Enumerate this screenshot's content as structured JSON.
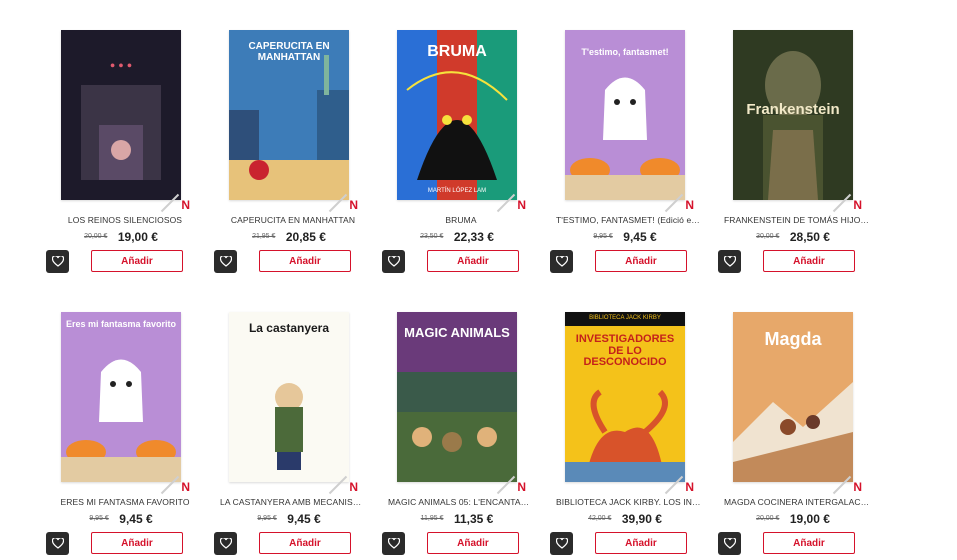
{
  "badge_letter": "N",
  "products": [
    {
      "title": "LOS REINOS SILENCIOSOS",
      "old_price": "20,00 €",
      "price": "19,00 €",
      "add_label": "Añadir",
      "cover_text": "",
      "cover_author": "",
      "colors": {
        "bg": "#1d1a2a",
        "accent": "#b0203a",
        "text": "#e05a6e"
      }
    },
    {
      "title": "CAPERUCITA EN MANHATTAN",
      "old_price": "21,95 €",
      "price": "20,85 €",
      "add_label": "Añadir",
      "cover_text": "CAPERUCITA EN MANHATTAN",
      "cover_author": "",
      "colors": {
        "bg": "#3d7cb8",
        "accent": "#e0b24a",
        "text": "#ffffff"
      }
    },
    {
      "title": "BRUMA",
      "old_price": "23,50 €",
      "price": "22,33 €",
      "add_label": "Añadir",
      "cover_text": "BRUMA",
      "cover_author": "MARTÍN LÓPEZ LAM",
      "colors": {
        "bg": "#d03a2b",
        "accent": "#2a6fd6",
        "text": "#ffffff"
      }
    },
    {
      "title": "T'ESTIMO, FANTASMET! (Edició en c...",
      "old_price": "9,95 €",
      "price": "9,45 €",
      "add_label": "Añadir",
      "cover_text": "T'estimo, fantasmet!",
      "cover_author": "",
      "colors": {
        "bg": "#b98ed6",
        "accent": "#f08a2b",
        "text": "#ffffff"
      }
    },
    {
      "title": "FRANKENSTEIN DE TOMÁS HIJO (No...",
      "old_price": "30,00 €",
      "price": "28,50 €",
      "add_label": "Añadir",
      "cover_text": "Frankenstein",
      "cover_author": "",
      "colors": {
        "bg": "#2f3a22",
        "accent": "#8a7a4a",
        "text": "#f2e9c8"
      }
    },
    {
      "title": "ERES MI FANTASMA FAVORITO",
      "old_price": "9,95 €",
      "price": "9,45 €",
      "add_label": "Añadir",
      "cover_text": "Eres mi fantasma favorito",
      "cover_author": "",
      "colors": {
        "bg": "#b98ed6",
        "accent": "#f08a2b",
        "text": "#ffffff"
      }
    },
    {
      "title": "LA CASTANYERA AMB MECANISMES...",
      "old_price": "9,95 €",
      "price": "9,45 €",
      "add_label": "Añadir",
      "cover_text": "La castanyera",
      "cover_author": "",
      "colors": {
        "bg": "#fbfaf3",
        "accent": "#c65a26",
        "text": "#1a1a1a"
      }
    },
    {
      "title": "MAGIC ANIMALS 05: L'ENCANTADO...",
      "old_price": "11,95 €",
      "price": "11,35 €",
      "add_label": "Añadir",
      "cover_text": "MAGIC ANIMALS",
      "cover_author": "",
      "colors": {
        "bg": "#3a5a4a",
        "accent": "#9a4aa6",
        "text": "#ffffff"
      }
    },
    {
      "title": "BIBLIOTECA JACK KIRBY. LOS INVES...",
      "old_price": "42,00 €",
      "price": "39,90 €",
      "add_label": "Añadir",
      "cover_text": "INVESTIGADORES DE LO DESCONOCIDO",
      "cover_author": "BIBLIOTECA JACK KIRBY",
      "colors": {
        "bg": "#f4c21a",
        "accent": "#d8532a",
        "text": "#c4221a"
      }
    },
    {
      "title": "MAGDA COCINERA INTERGALACTIC...",
      "old_price": "20,00 €",
      "price": "19,00 €",
      "add_label": "Añadir",
      "cover_text": "Magda",
      "cover_author": "",
      "colors": {
        "bg": "#e7a86a",
        "accent": "#8a4a2a",
        "text": "#ffffff"
      }
    }
  ]
}
